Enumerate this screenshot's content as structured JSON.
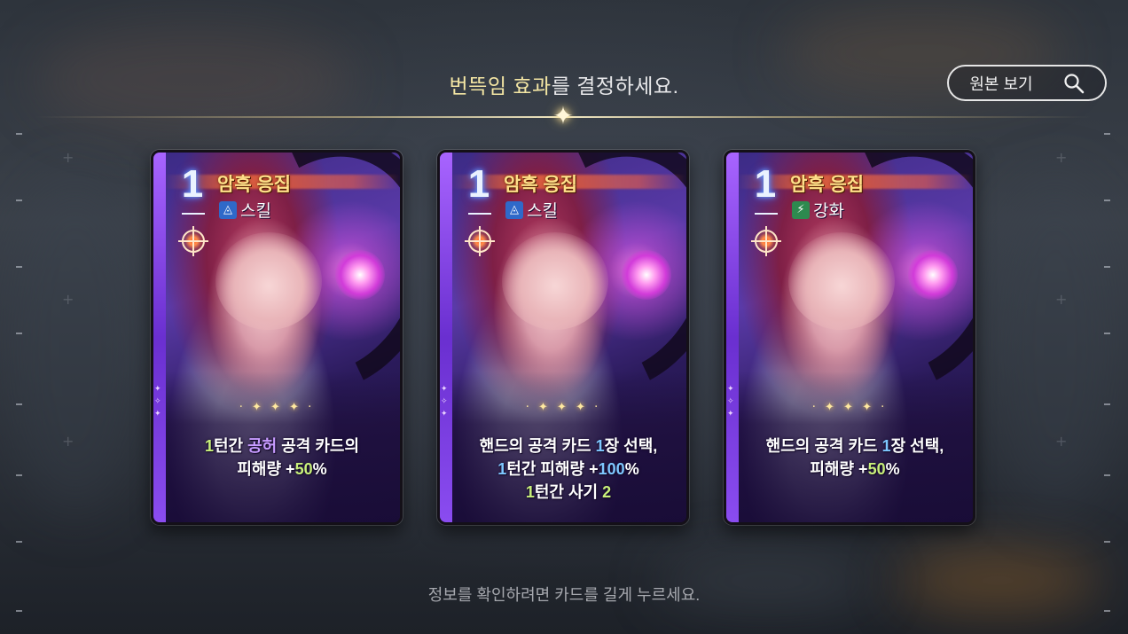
{
  "header": {
    "title_highlight": "번뜩임 효과",
    "title_rest": "를 결정하세요.",
    "view_original_label": "원본 보기"
  },
  "cards": [
    {
      "cost": "1",
      "name": "암흑 응집",
      "type_label": "스킬",
      "type_icon": "skill-icon",
      "description": [
        [
          {
            "t": "1",
            "c": "n"
          },
          {
            "t": "턴간 ",
            "c": ""
          },
          {
            "t": "공허",
            "c": "k"
          },
          {
            "t": " 공격 카드의",
            "c": ""
          }
        ],
        [
          {
            "t": "피해량 +",
            "c": ""
          },
          {
            "t": "50",
            "c": "n"
          },
          {
            "t": "%",
            "c": ""
          }
        ]
      ]
    },
    {
      "cost": "1",
      "name": "암흑 응집",
      "type_label": "스킬",
      "type_icon": "skill-icon",
      "description": [
        [
          {
            "t": "핸드의 공격 카드 ",
            "c": ""
          },
          {
            "t": "1",
            "c": "v"
          },
          {
            "t": "장 선택,",
            "c": ""
          }
        ],
        [
          {
            "t": "1",
            "c": "v"
          },
          {
            "t": "턴간 피해량 +",
            "c": ""
          },
          {
            "t": "100",
            "c": "v"
          },
          {
            "t": "%",
            "c": ""
          }
        ],
        [
          {
            "t": "1",
            "c": "n"
          },
          {
            "t": "턴간 사기 ",
            "c": ""
          },
          {
            "t": "2",
            "c": "n"
          }
        ]
      ]
    },
    {
      "cost": "1",
      "name": "암흑 응집",
      "type_label": "강화",
      "type_icon": "lightning-icon",
      "description": [
        [
          {
            "t": "핸드의 공격 카드 ",
            "c": ""
          },
          {
            "t": "1",
            "c": "v"
          },
          {
            "t": "장 선택,",
            "c": ""
          }
        ],
        [
          {
            "t": "피해량 +",
            "c": ""
          },
          {
            "t": "50",
            "c": "n"
          },
          {
            "t": "%",
            "c": ""
          }
        ]
      ]
    }
  ],
  "footer": {
    "hint": "정보를 확인하려면 카드를 길게 누르세요."
  },
  "colors": {
    "title_highlight": "#f4e6a4",
    "card_name": "#ffe08a",
    "number_green": "#c8f07a",
    "number_blue": "#7ec8ff",
    "keyword_purple": "#c79bff"
  }
}
